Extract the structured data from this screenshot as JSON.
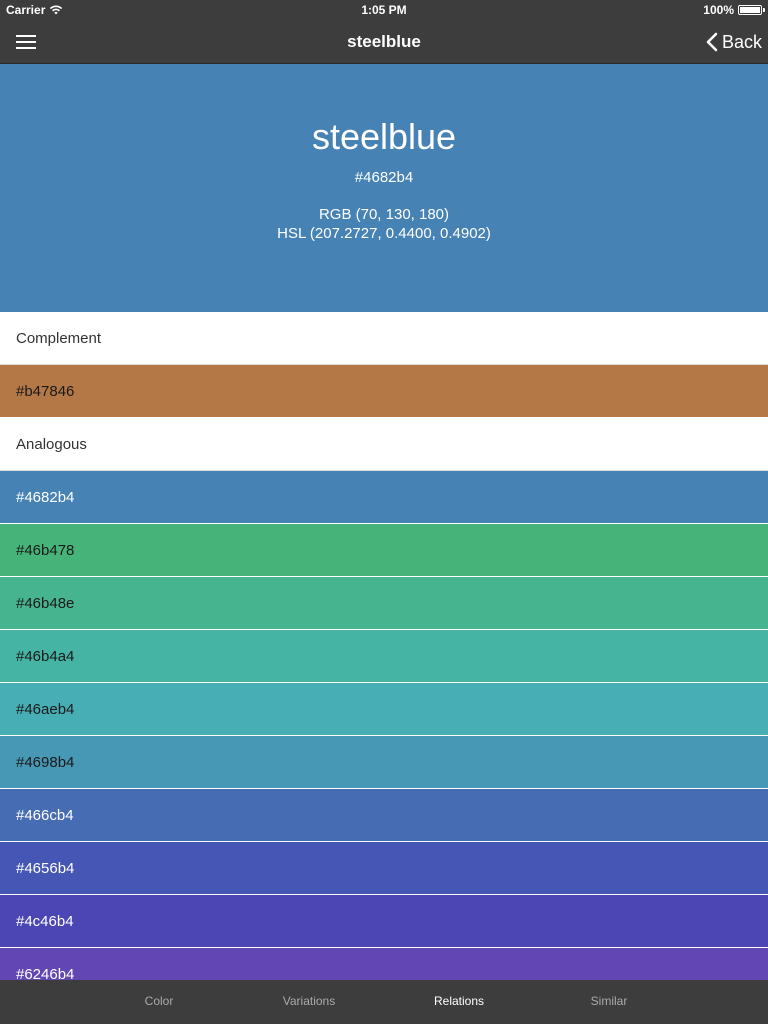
{
  "status": {
    "carrier": "Carrier",
    "time": "1:05 PM",
    "battery": "100%"
  },
  "nav": {
    "title": "steelblue",
    "back_label": "Back"
  },
  "color": {
    "name": "steelblue",
    "hex": "#4682b4",
    "rgb": "RGB (70, 130, 180)",
    "hsl": "HSL (207.2727, 0.4400, 0.4902)",
    "swatch": "#4682b4"
  },
  "sections": {
    "complement": {
      "label": "Complement",
      "swatches": [
        {
          "hex": "#b47846",
          "fill": "#b47846",
          "text_color": "#1a1a1a"
        }
      ]
    },
    "analogous": {
      "label": "Analogous",
      "swatches": [
        {
          "hex": "#4682b4",
          "fill": "#4682b4",
          "text_color": "#ffffff"
        },
        {
          "hex": "#46b478",
          "fill": "#46b478",
          "text_color": "#1a1a1a"
        },
        {
          "hex": "#46b48e",
          "fill": "#46b48e",
          "text_color": "#1a1a1a"
        },
        {
          "hex": "#46b4a4",
          "fill": "#46b4a4",
          "text_color": "#1a1a1a"
        },
        {
          "hex": "#46aeb4",
          "fill": "#46aeb4",
          "text_color": "#1a1a1a"
        },
        {
          "hex": "#4698b4",
          "fill": "#4698b4",
          "text_color": "#1a1a1a"
        },
        {
          "hex": "#466cb4",
          "fill": "#466cb4",
          "text_color": "#ffffff"
        },
        {
          "hex": "#4656b4",
          "fill": "#4656b4",
          "text_color": "#ffffff"
        },
        {
          "hex": "#4c46b4",
          "fill": "#4c46b4",
          "text_color": "#ffffff"
        },
        {
          "hex": "#6246b4",
          "fill": "#6246b4",
          "text_color": "#ffffff"
        }
      ]
    }
  },
  "tabs": [
    {
      "label": "Color",
      "active": false
    },
    {
      "label": "Variations",
      "active": false
    },
    {
      "label": "Relations",
      "active": true
    },
    {
      "label": "Similar",
      "active": false
    }
  ]
}
